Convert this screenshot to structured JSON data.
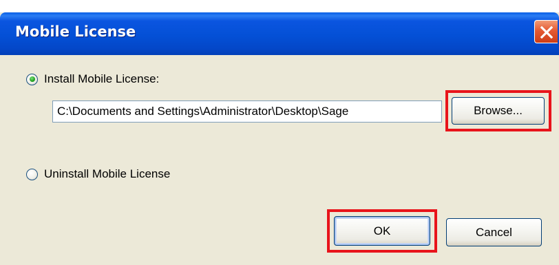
{
  "window": {
    "title": "Mobile License"
  },
  "install": {
    "label": "Install Mobile License:",
    "selected": true,
    "path_value": "C:\\Documents and Settings\\Administrator\\Desktop\\Sage",
    "browse_label": "Browse..."
  },
  "uninstall": {
    "label": "Uninstall Mobile License",
    "selected": false
  },
  "footer": {
    "ok_label": "OK",
    "cancel_label": "Cancel"
  },
  "colors": {
    "titlebar": "#0450d6",
    "dialog_background": "#ece9d8",
    "highlight_box": "#e8141b",
    "close_button": "#e45a33"
  },
  "icons": {
    "close": "close-icon"
  }
}
